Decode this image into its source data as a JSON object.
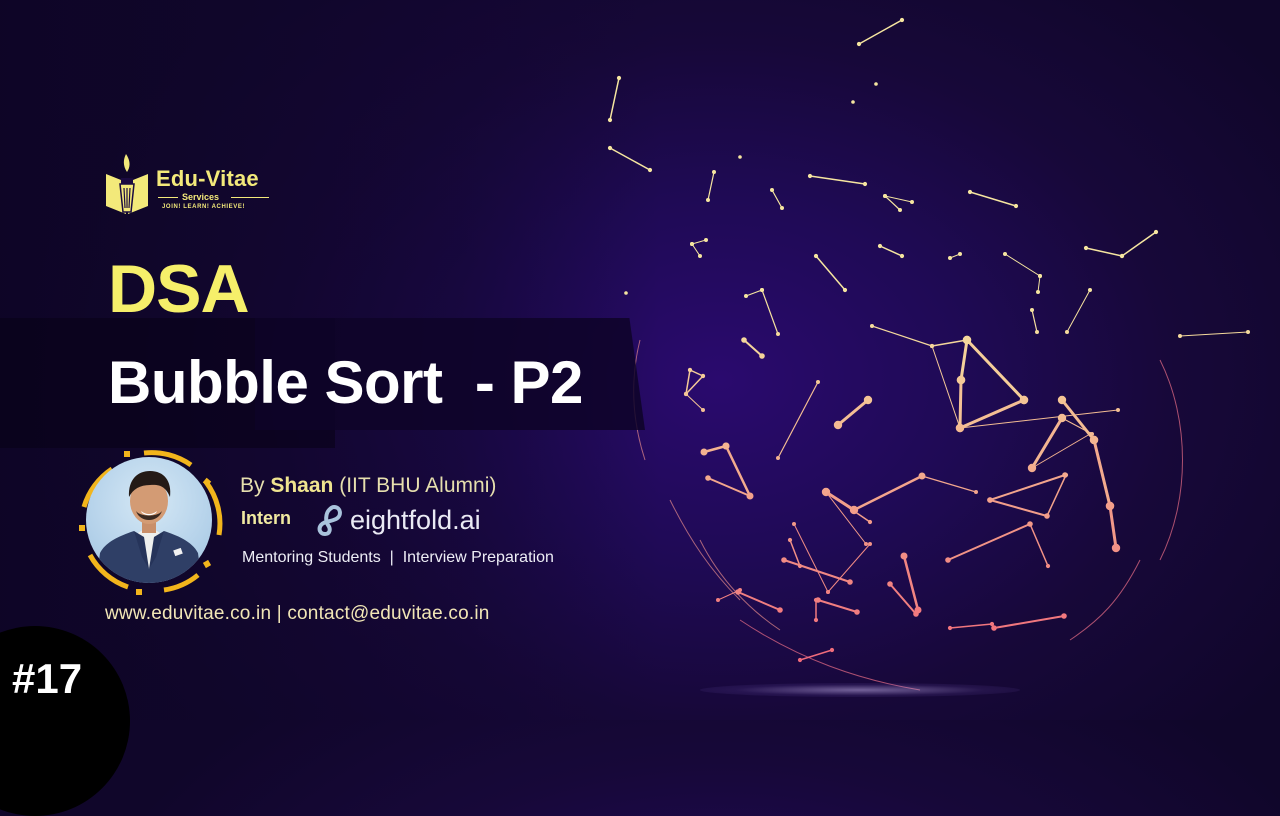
{
  "brand": {
    "name": "Edu-Vitae",
    "subtitle": "Services",
    "tagline": "JOIN! LEARN! ACHIEVE!",
    "logo_icon": "book-torch-icon",
    "accent_color": "#f3e97a"
  },
  "title": {
    "topic": "DSA",
    "lesson": "Bubble Sort  - P2"
  },
  "presenter": {
    "by_prefix": "By ",
    "name": "Shaan",
    "credential": " (IIT BHU Alumni)",
    "role_label": "Intern",
    "company": "eightfold.ai",
    "company_icon": "eightfold-logo-icon",
    "services": "Mentoring Students  |  Interview Preparation",
    "photo": "presenter-photo"
  },
  "contact": {
    "text": "www.eduvitae.co.in | contact@eduvitae.co.in"
  },
  "episode": {
    "label": "#17"
  },
  "background": {
    "theme": "constellation-globe",
    "base_color": "#1a0848",
    "node_color_top": "#f6e6a0",
    "node_color_bottom": "#f06a7a"
  }
}
